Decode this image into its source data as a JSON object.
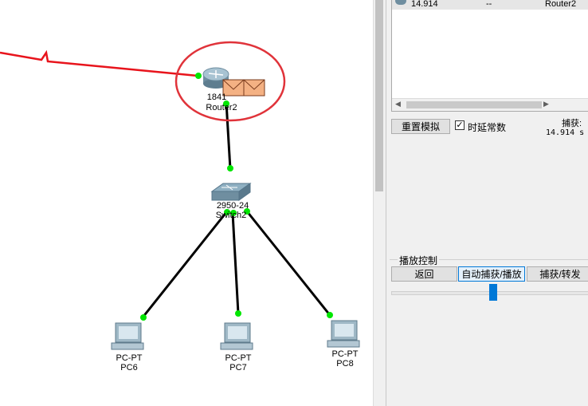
{
  "topology": {
    "router": {
      "model": "1841",
      "name": "Router2"
    },
    "switch": {
      "model": "2950-24",
      "name": "Switch2"
    },
    "pcs": [
      {
        "model": "PC-PT",
        "name": "PC6"
      },
      {
        "model": "PC-PT",
        "name": "PC7"
      },
      {
        "model": "PC-PT",
        "name": "PC8"
      }
    ],
    "colors": {
      "serial_link": "#e8141c",
      "highlight_circle": "#e0333a",
      "port_up": "#00e600",
      "pdu": "#f4b183"
    }
  },
  "event_list": {
    "row": {
      "time": "14.914",
      "last_device": "--",
      "at_device": "Router2"
    }
  },
  "sim_controls": {
    "reset_label": "重置模拟",
    "constant_delay_label": "时延常数",
    "constant_delay_checked": true,
    "captured_label": "捕获:",
    "captured_time": "14.914 s"
  },
  "playback": {
    "group_label": "播放控制",
    "back_label": "返回",
    "auto_capture_label": "自动捕获/播放",
    "capture_forward_label": "捕获/转发"
  }
}
